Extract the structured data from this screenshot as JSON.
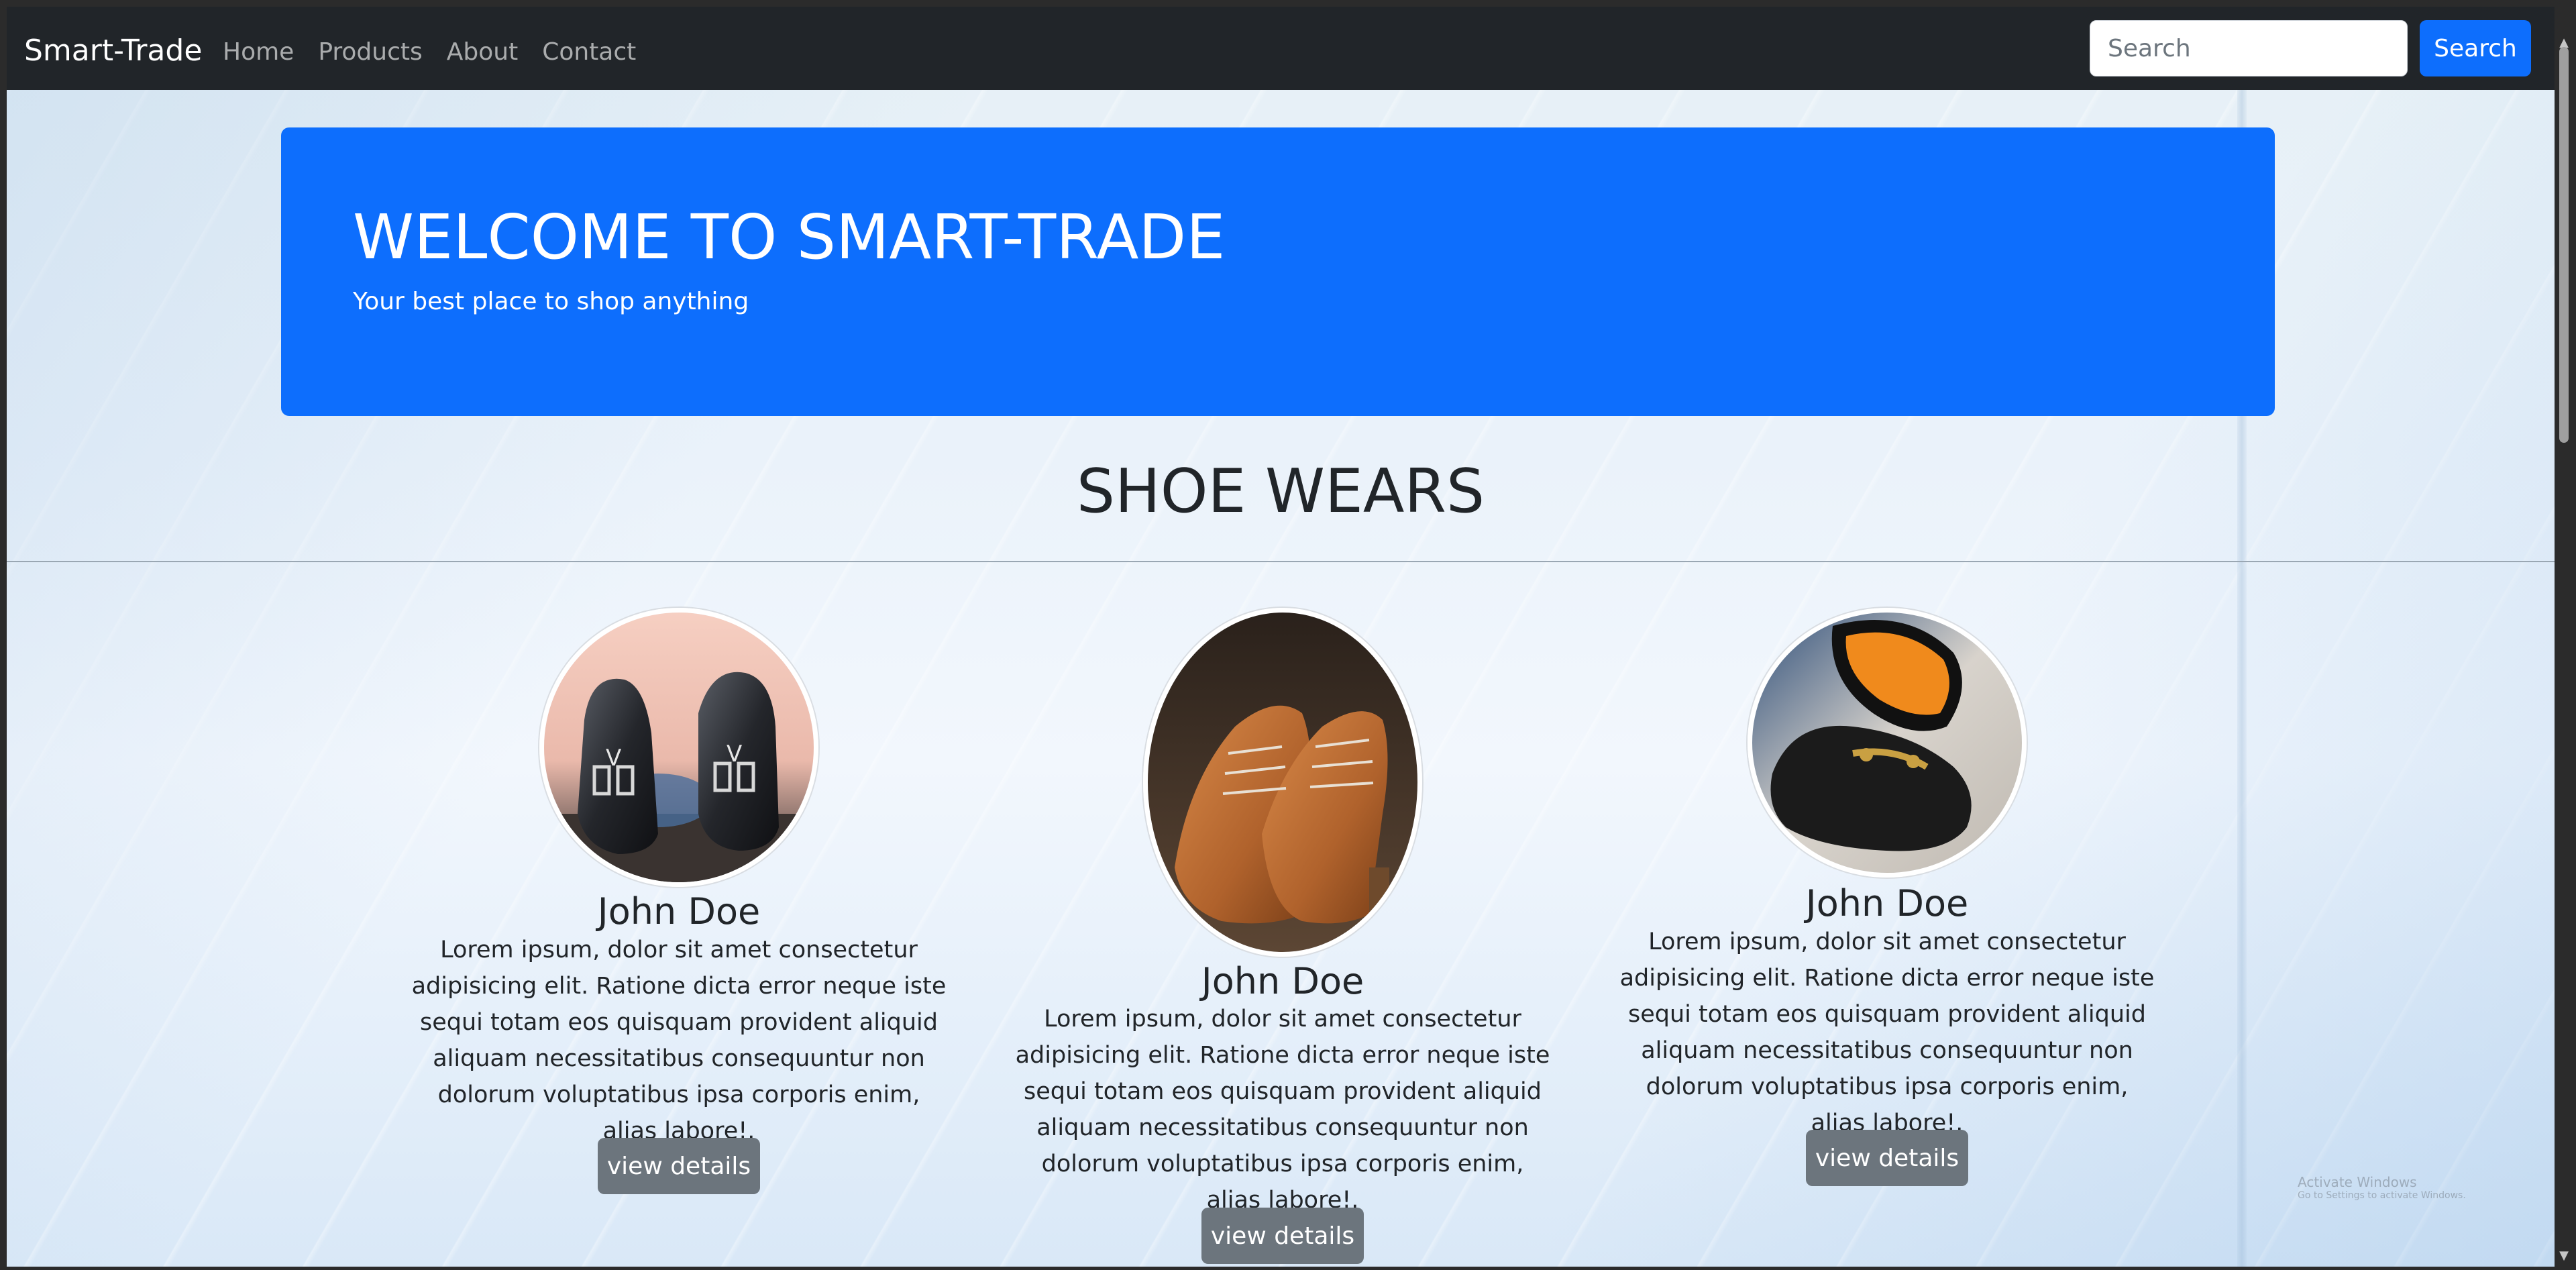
{
  "navbar": {
    "brand": "Smart-Trade",
    "links": [
      {
        "label": "Home"
      },
      {
        "label": "Products"
      },
      {
        "label": "About"
      },
      {
        "label": "Contact"
      }
    ],
    "search": {
      "placeholder": "Search",
      "button_label": "Search"
    }
  },
  "hero": {
    "title": "WELCOME TO SMART-TRADE",
    "subtitle": "Your best place to shop anything"
  },
  "section": {
    "title": "SHOE WEARS"
  },
  "products": [
    {
      "name": "John Doe",
      "description": "Lorem ipsum, dolor sit amet consectetur adipisicing elit. Ratione dicta error neque iste sequi totam eos quisquam provident aliquid aliquam necessitatibus consequuntur non dolorum voluptatibus ipsa corporis enim, alias labore!.",
      "button_label": "view details",
      "image": "black-monk-strap-shoes"
    },
    {
      "name": "John Doe",
      "description": "Lorem ipsum, dolor sit amet consectetur adipisicing elit. Ratione dicta error neque iste sequi totam eos quisquam provident aliquid aliquam necessitatibus consequuntur non dolorum voluptatibus ipsa corporis enim, alias labore!.",
      "button_label": "view details",
      "image": "brown-suede-derby-shoes"
    },
    {
      "name": "John Doe",
      "description": "Lorem ipsum, dolor sit amet consectetur adipisicing elit. Ratione dicta error neque iste sequi totam eos quisquam provident aliquid aliquam necessitatibus consequuntur non dolorum voluptatibus ipsa corporis enim, alias labore!.",
      "button_label": "view details",
      "image": "black-loafer-orange-sole"
    }
  ],
  "watermark": {
    "title": "Activate Windows",
    "subtitle": "Go to Settings to activate Windows."
  },
  "colors": {
    "navbar_bg": "#212529",
    "primary": "#0d6efd",
    "secondary": "#6c757d"
  }
}
